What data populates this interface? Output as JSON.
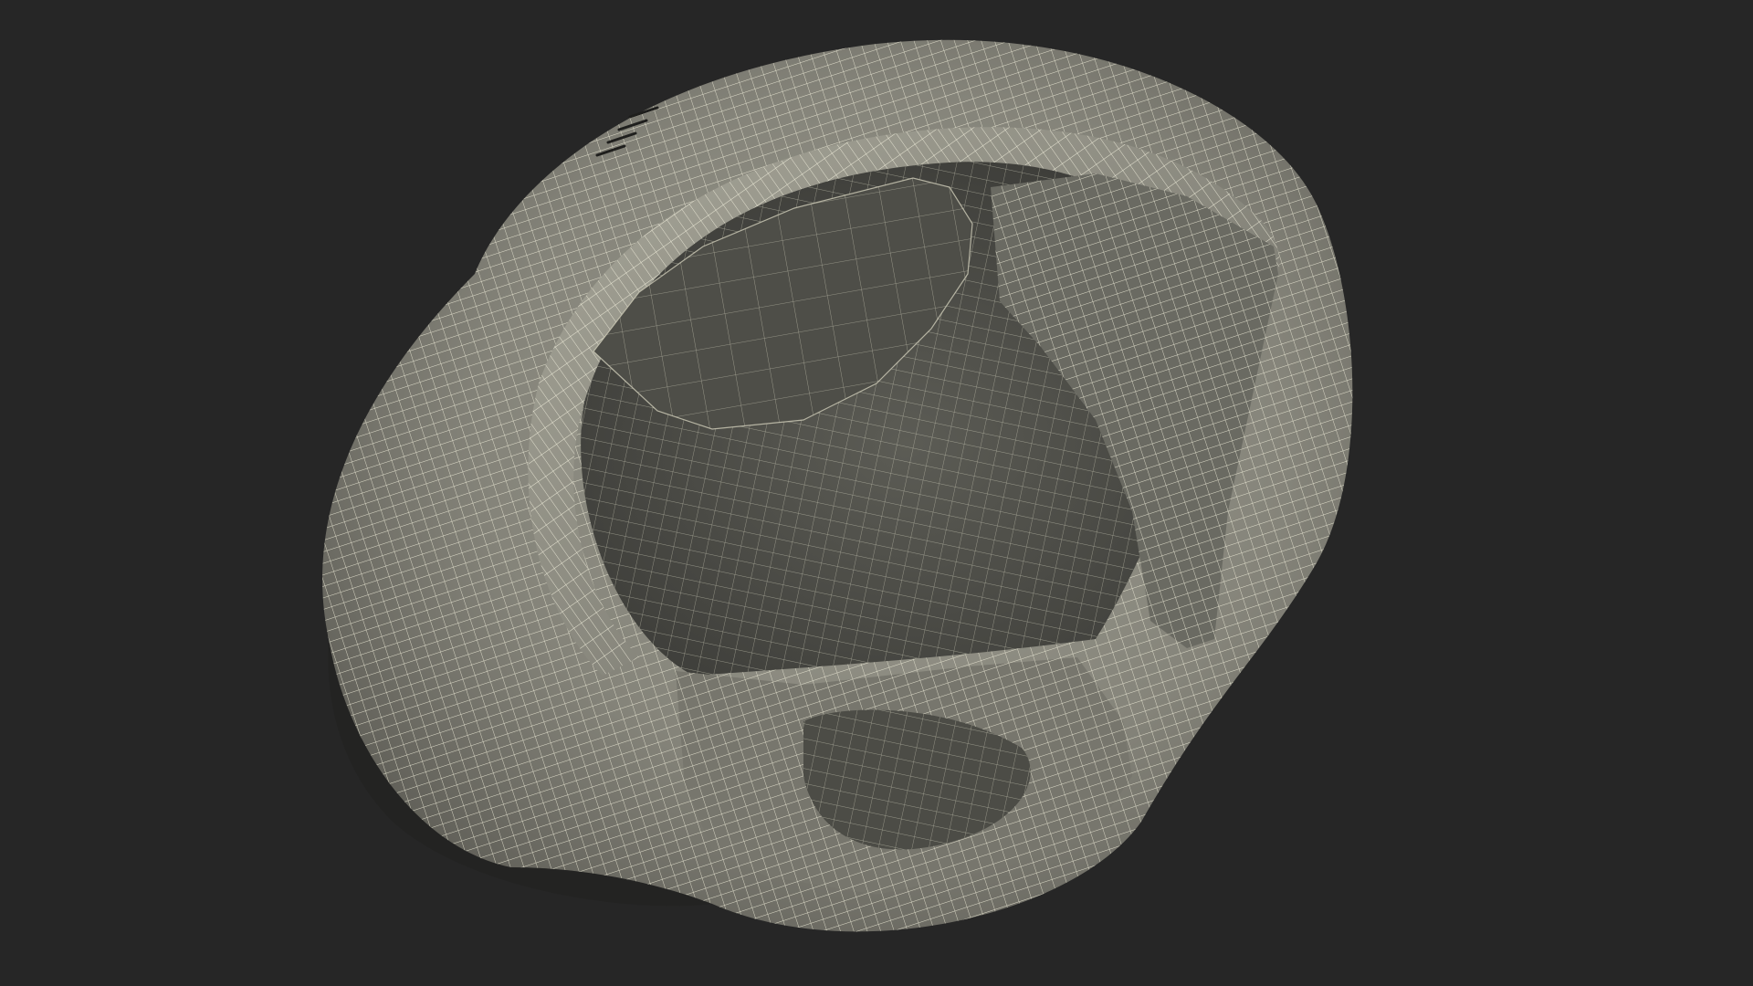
{
  "scene": {
    "subject": "helmet-wireframe",
    "colors": {
      "background": "#262626",
      "shell": "#8d8c80",
      "shell_shadow": "#575750",
      "interior": "#4b4b46",
      "wire": "#f2f0dc"
    }
  }
}
